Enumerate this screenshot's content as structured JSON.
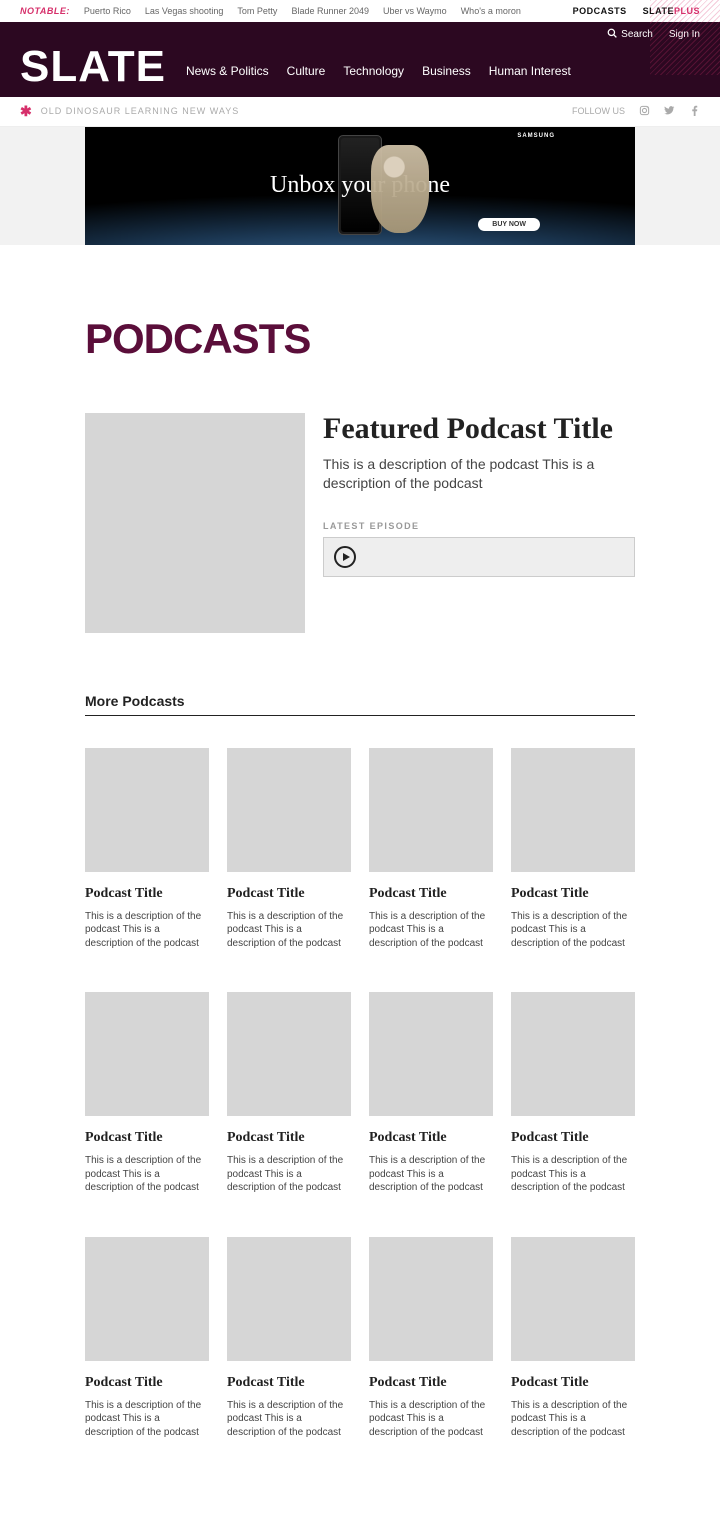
{
  "topStrip": {
    "notable": "NOTABLE:",
    "links": [
      "Puerto Rico",
      "Las Vegas shooting",
      "Tom Petty",
      "Blade Runner 2049",
      "Uber vs Waymo",
      "Who's a moron"
    ],
    "podcasts": "PODCASTS",
    "slate": "SLATE",
    "plus": "PLUS"
  },
  "nav": {
    "search": "Search",
    "signIn": "Sign In",
    "logo": "SLATE",
    "items": [
      "News & Politics",
      "Culture",
      "Technology",
      "Business",
      "Human Interest"
    ]
  },
  "subbar": {
    "tagline": "OLD DINOSAUR LEARNING NEW WAYS",
    "follow": "FOLLOW US"
  },
  "ad": {
    "brand": "SAMSUNG",
    "headline": "Unbox your phone",
    "cta": "BUY NOW"
  },
  "page": {
    "title": "PODCASTS",
    "moreHeading": "More Podcasts"
  },
  "featured": {
    "title": "Featured Podcast Title",
    "desc": "This is a description of the podcast This is a description of the podcast",
    "latestLabel": "LATEST EPISODE"
  },
  "cards": [
    {
      "title": "Podcast Title",
      "desc": "This is a description of the podcast This is a description of the podcast"
    },
    {
      "title": "Podcast Title",
      "desc": "This is a description of the podcast This is a description of the podcast"
    },
    {
      "title": "Podcast Title",
      "desc": "This is a description of the podcast This is a description of the podcast"
    },
    {
      "title": "Podcast Title",
      "desc": "This is a description of the podcast This is a description of the podcast"
    },
    {
      "title": "Podcast Title",
      "desc": "This is a description of the podcast This is a description of the podcast"
    },
    {
      "title": "Podcast Title",
      "desc": "This is a description of the podcast This is a description of the podcast"
    },
    {
      "title": "Podcast Title",
      "desc": "This is a description of the podcast This is a description of the podcast"
    },
    {
      "title": "Podcast Title",
      "desc": "This is a description of the podcast This is a description of the podcast"
    },
    {
      "title": "Podcast Title",
      "desc": "This is a description of the podcast This is a description of the podcast"
    },
    {
      "title": "Podcast Title",
      "desc": "This is a description of the podcast This is a description of the podcast"
    },
    {
      "title": "Podcast Title",
      "desc": "This is a description of the podcast This is a description of the podcast"
    },
    {
      "title": "Podcast Title",
      "desc": "This is a description of the podcast This is a description of the podcast"
    }
  ]
}
